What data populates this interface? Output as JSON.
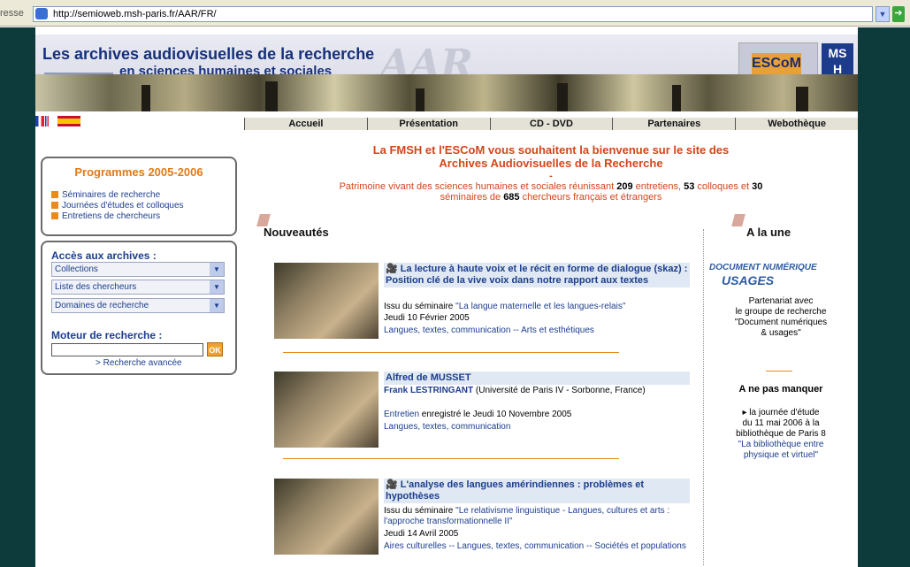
{
  "browser": {
    "address_label": "resse",
    "url": "http://semioweb.msh-paris.fr/AAR/FR/",
    "go_label": "OK"
  },
  "header": {
    "title_line1": "Les archives audiovisuelles de la recherche",
    "title_line2": "en sciences humaines et sociales",
    "watermark": "AAR",
    "escom_logo": "ESCoM",
    "msh_logo_line1": "MS",
    "msh_logo_line2": "H"
  },
  "nav": {
    "items": [
      "Accueil",
      "Présentation",
      "CD - DVD",
      "Partenaires",
      "Webothèque"
    ]
  },
  "programmes": {
    "title": "Programmes 2005-2006",
    "items": [
      "Séminaires de recherche",
      "Journées d'études et colloques",
      "Entretiens de chercheurs"
    ]
  },
  "acces": {
    "title": "Accès aux archives :",
    "selects": [
      "Collections",
      "Liste des chercheurs",
      "Domaines de recherche"
    ],
    "moteur_title": "Moteur de recherche :",
    "ok_label": "OK",
    "advanced_link": "> Recherche avancée"
  },
  "welcome": {
    "line1": "La FMSH et l'ESCoM vous souhaitent la bienvenue sur le site des",
    "line2": "Archives Audiovisuelles de la Recherche",
    "dash": "-",
    "patr1_a": "Patrimoine vivant des sciences humaines et sociales réunissant ",
    "patr1_n1": "209",
    "patr1_b": " entretiens, ",
    "patr1_n2": "53",
    "patr1_c": " colloques et ",
    "patr1_n3": "30",
    "patr2_a": "séminaires de ",
    "patr2_n": "685",
    "patr2_b": " chercheurs français et étrangers"
  },
  "nouveautes": {
    "heading": "Nouveautés",
    "articles": [
      {
        "title": "La lecture à haute voix et le récit en forme de dialogue (skaz) : Position clé de la vive voix dans notre rapport aux textes",
        "line1_prefix": "Issu du  séminaire ",
        "line1_link": "\"La langue maternelle et les langues-relais\"",
        "date": "Jeudi 10 Février 2005",
        "topics": "Langues, textes, communication -- Arts et esthétiques"
      },
      {
        "title": "Alfred de MUSSET",
        "author": "Frank LESTRINGANT",
        "author_aff": " (Université de Paris IV - Sorbonne, France)",
        "line_link": "Entretien",
        "line_rest": " enregistré le  Jeudi 10 Novembre 2005",
        "topics": "Langues, textes, communication"
      },
      {
        "title": "L'analyse des langues amérindiennes : problèmes et hypothèses",
        "line1_prefix": "Issu du  séminaire ",
        "line1_link": "\"Le relativisme linguistique - Langues, cultures et arts : l'approche transformationnelle II\"",
        "date": "Jeudi 14 Avril 2005",
        "topics": "Aires culturelles -- Langues, textes, communication -- Sociétés et populations"
      }
    ]
  },
  "une": {
    "heading": "A la une",
    "logo_line1": "DOCUMENT NUMÉRIQUE",
    "logo_line2": "USAGES",
    "partner_lines": [
      "Partenariat avec",
      "le groupe de recherche",
      "\"Document numériques",
      "& usages\""
    ],
    "ne_pas_manquer": "A ne pas manquer",
    "event_lines": [
      "▸ la journée d'étude",
      "du 11 mai 2006 à la",
      "bibliothèque de Paris 8"
    ],
    "event_link_lines": [
      "\"La bibliothèque entre",
      "physique et virtuel\""
    ]
  }
}
